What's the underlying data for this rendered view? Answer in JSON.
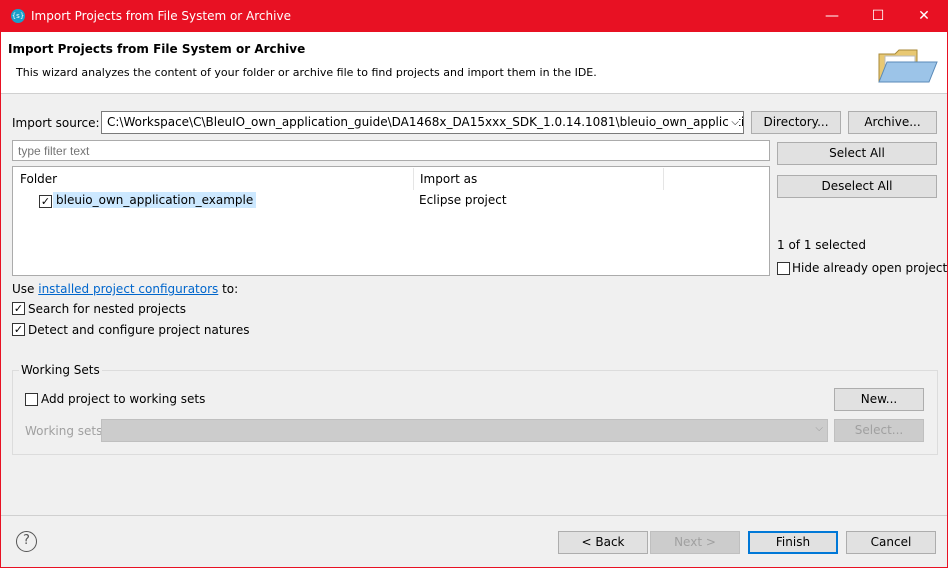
{
  "window": {
    "title": "Import Projects from File System or Archive",
    "icon": "app-icon",
    "icon_text": "{s}",
    "minimize": "—",
    "maximize": "☐",
    "close": "✕"
  },
  "header": {
    "title": "Import Projects from File System or Archive",
    "description": "This wizard analyzes the content of your folder or archive file to find projects and import them in the IDE."
  },
  "source": {
    "label": "Import source:",
    "value": "C:\\Workspace\\C\\BleuIO_own_application_guide\\DA1468x_DA15xxx_SDK_1.0.14.1081\\bleuio_own_application_exampl",
    "directory": "Directory...",
    "archive": "Archive..."
  },
  "filter": {
    "placeholder": "type filter text"
  },
  "table": {
    "columns": [
      "Folder",
      "Import as"
    ],
    "rows": [
      {
        "folder": "bleuio_own_application_example",
        "import_as": "Eclipse project",
        "checked": true
      }
    ]
  },
  "side": {
    "select_all": "Select All",
    "deselect_all": "Deselect All",
    "selected_count": "1 of 1 selected",
    "hide_open": "Hide already open projects"
  },
  "options": {
    "use_prefix": "Use ",
    "link": "installed project configurators",
    "use_suffix": " to:",
    "nested": "Search for nested projects",
    "detect": "Detect and configure project natures"
  },
  "working_sets": {
    "title": "Working Sets",
    "add": "Add project to working sets",
    "new": "New...",
    "label": "Working sets:",
    "select": "Select..."
  },
  "footer": {
    "help": "?",
    "back": "< Back",
    "next": "Next >",
    "finish": "Finish",
    "cancel": "Cancel"
  }
}
